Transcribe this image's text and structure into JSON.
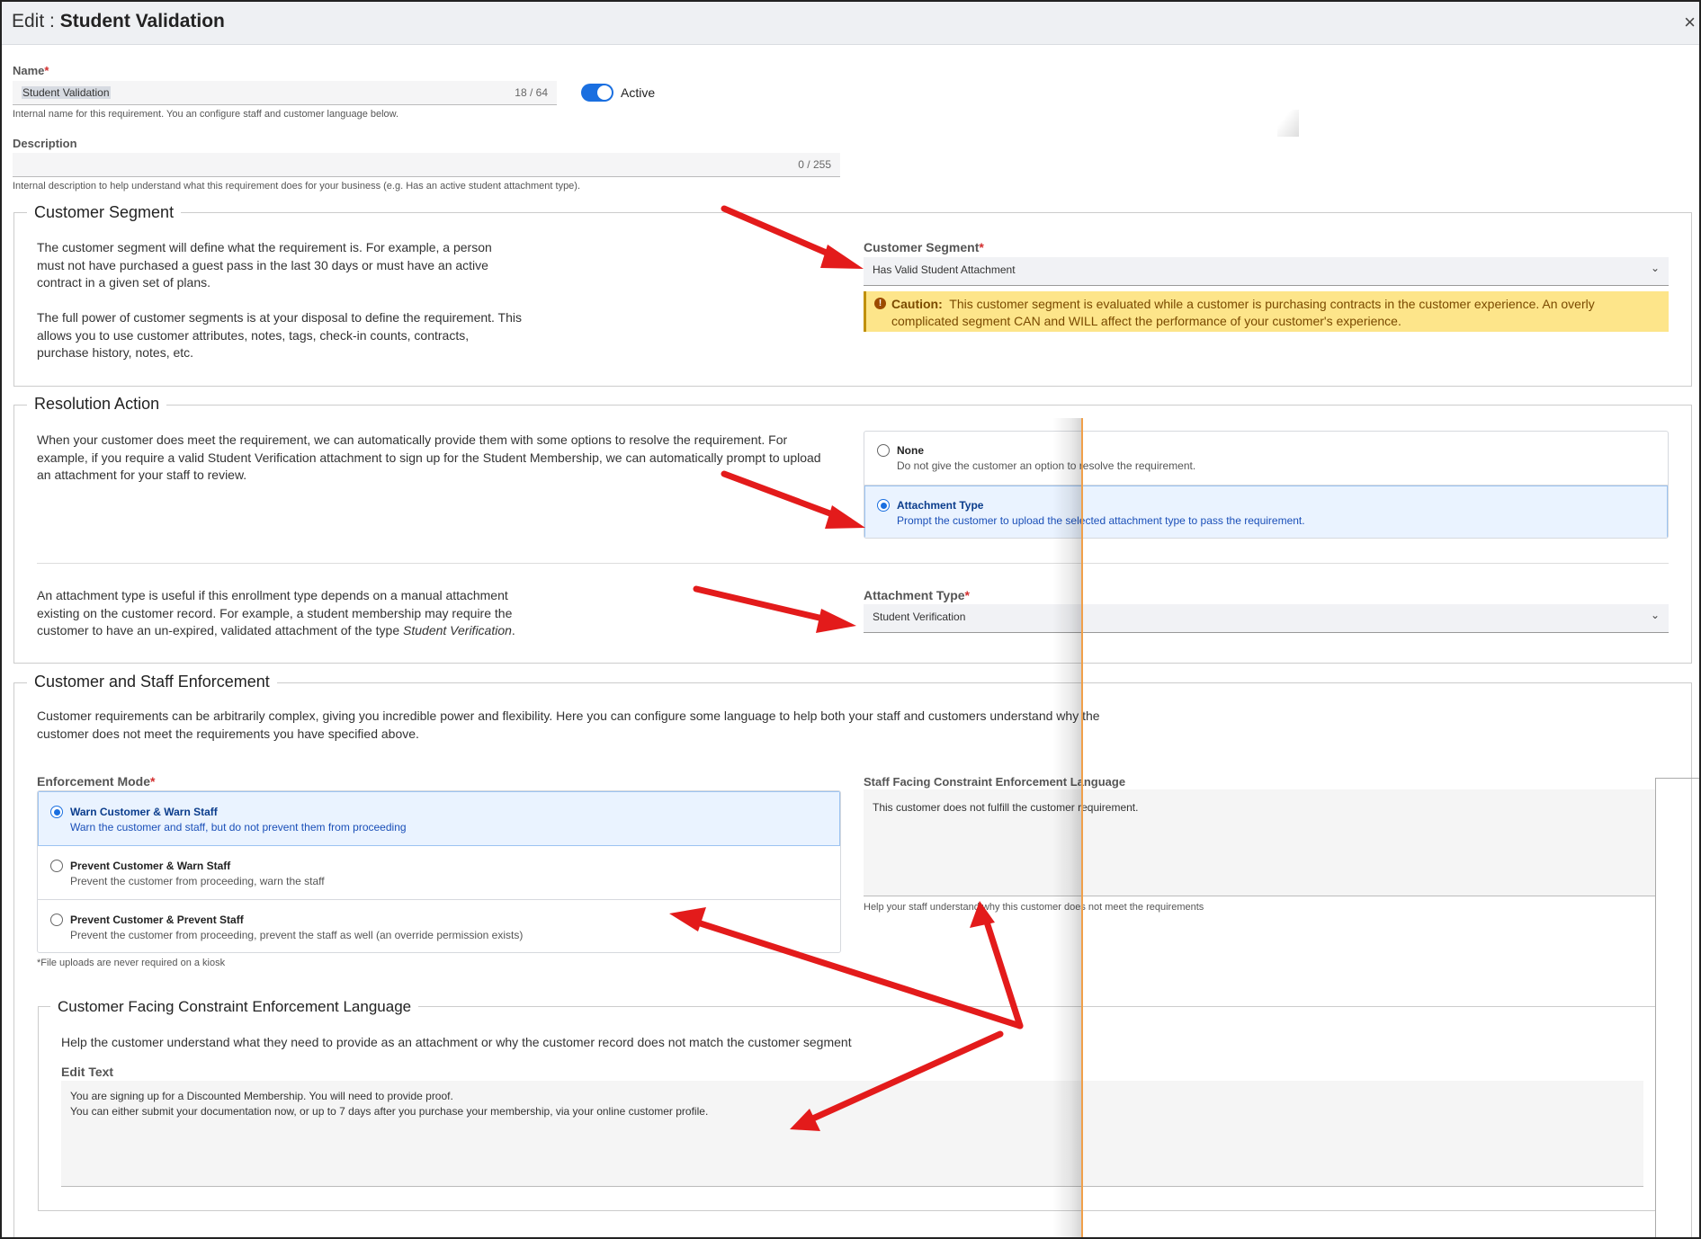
{
  "header": {
    "title_prefix": "Edit : ",
    "title_name": "Student Validation",
    "close_label": "×"
  },
  "name_field": {
    "label": "Name",
    "required_mark": "*",
    "value": "Student Validation",
    "counter": "18 / 64",
    "helper": "Internal name for this requirement. You an configure staff and customer language below."
  },
  "active_toggle": {
    "label": "Active",
    "on": true
  },
  "description_field": {
    "label": "Description",
    "value": "",
    "counter": "0 / 255",
    "helper": "Internal description to help understand what this requirement does for your business (e.g. Has an active student attachment type)."
  },
  "customer_segment": {
    "legend": "Customer Segment",
    "para1": "The customer segment will define what the requirement is. For example, a person must not have purchased a guest pass in the last 30 days or must have an active contract in a given set of plans.",
    "para2": "The full power of customer segments is at your disposal to define the requirement. This allows you to use customer attributes, notes, tags, check-in counts, contracts, purchase history, notes, etc.",
    "select_label": "Customer Segment",
    "required_mark": "*",
    "select_value": "Has Valid Student Attachment",
    "caution_title": "Caution:",
    "caution_text": "This customer segment is evaluated while a customer is purchasing contracts in the customer experience. An overly complicated segment CAN and WILL affect the performance of your customer's experience."
  },
  "resolution_action": {
    "legend": "Resolution Action",
    "para": "When your customer does meet the requirement, we can automatically provide them with some options to resolve the requirement. For example, if you require a valid Student Verification attachment to sign up for the Student Membership, we can automatically prompt to upload an attachment for your staff to review.",
    "options": [
      {
        "label": "None",
        "desc": "Do not give the customer an option to resolve the requirement.",
        "selected": false
      },
      {
        "label": "Attachment Type",
        "desc": "Prompt the customer to upload the selected attachment type to pass the requirement.",
        "selected": true
      }
    ],
    "attachment_para_1": "An attachment type is useful if this enrollment type depends on a manual attachment existing on the customer record. For example, a student membership may require the customer to have an un-expired, validated attachment of the type ",
    "attachment_para_em": "Student Verification",
    "attachment_para_end": ".",
    "attachment_label": "Attachment Type",
    "required_mark": "*",
    "attachment_value": "Student Verification"
  },
  "enforcement": {
    "legend": "Customer and Staff Enforcement",
    "para": "Customer requirements can be arbitrarily complex, giving you incredible power and flexibility. Here you can configure some language to help both your staff and customers understand why the customer does not meet the requirements you have specified above.",
    "mode_label": "Enforcement Mode",
    "required_mark": "*",
    "modes": [
      {
        "label": "Warn Customer & Warn Staff",
        "desc": "Warn the customer and staff, but do not prevent them from proceeding",
        "selected": true
      },
      {
        "label": "Prevent Customer & Warn Staff",
        "desc": "Prevent the customer from proceeding, warn the staff",
        "selected": false
      },
      {
        "label": "Prevent Customer & Prevent Staff",
        "desc": "Prevent the customer from proceeding, prevent the staff as well (an override permission exists)",
        "selected": false
      }
    ],
    "kiosk_note": "*File uploads are never required on a kiosk",
    "staff_label": "Staff Facing Constraint Enforcement Language",
    "staff_value": "This customer does not fulfill the customer requirement.",
    "staff_helper": "Help your staff understand why this customer does not meet the requirements"
  },
  "customer_language": {
    "legend": "Customer Facing Constraint Enforcement Language",
    "intro": "Help the customer understand what they need to provide as an attachment or why the customer record does not match the customer segment",
    "edit_label": "Edit Text",
    "line1": "You are signing up for a Discounted Membership. You will need to provide proof.",
    "line2": "You can either submit your documentation now, or up to 7 days after you purchase your membership, via your online customer profile."
  },
  "annotation_color": "#e31b1b",
  "accent_color": "#1a6fe0",
  "caution_color": "#fde58a"
}
